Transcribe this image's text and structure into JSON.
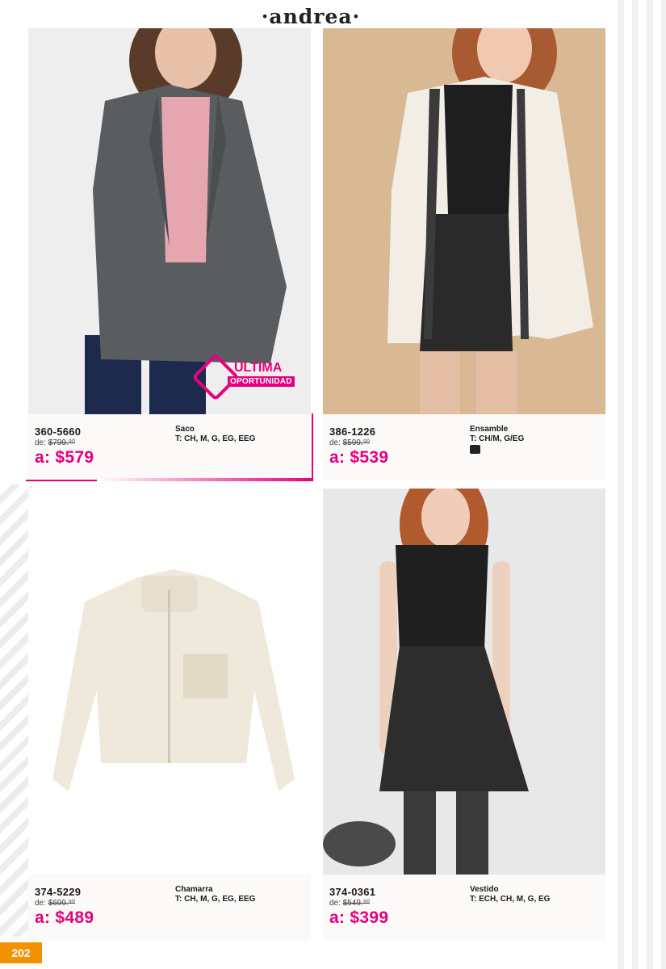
{
  "brand": "·andrea·",
  "page_number": "202",
  "badge": {
    "line1": "ÚLTIMA",
    "line2": "OPORTUNIDAD"
  },
  "colors": {
    "price": "#e6007e",
    "page_tab": "#f39200"
  },
  "products": [
    {
      "sku": "360-5660",
      "was_prefix": "de:",
      "was": "$799.⁹⁰",
      "now": "a: $579",
      "name": "Saco",
      "sizes": "T: CH, M, G, EG, EEG",
      "image": "gray blazer over pink top"
    },
    {
      "sku": "386-1226",
      "was_prefix": "de:",
      "was": "$599.⁹⁰",
      "now": "a: $539",
      "name": "Ensamble",
      "sizes": "T: CH/M, G/EG",
      "image": "white kimono with black top and shorts"
    },
    {
      "sku": "374-5229",
      "was_prefix": "de:",
      "was": "$699.⁹⁰",
      "now": "a: $489",
      "name": "Chamarra",
      "sizes": "T: CH, M, G, EG, EEG",
      "image": "cream sherpa jacket"
    },
    {
      "sku": "374-0361",
      "was_prefix": "de:",
      "was": "$549.⁹⁰",
      "now": "a: $399",
      "name": "Vestido",
      "sizes": "T: ECH, CH, M, G, EG",
      "image": "black sleeveless dress"
    }
  ]
}
